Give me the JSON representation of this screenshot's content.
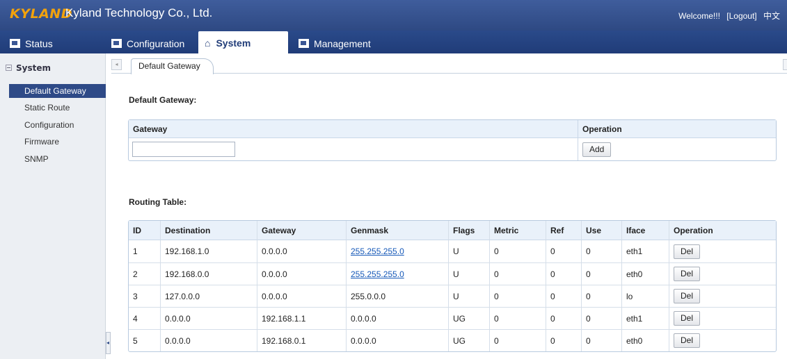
{
  "header": {
    "logo": "KYLAND",
    "company": "Kyland Technology Co., Ltd.",
    "welcome": "Welcome!!!",
    "logout": "[Logout]",
    "language": "中文"
  },
  "nav": {
    "tabs": [
      {
        "label": "Status",
        "icon": "status-icon"
      },
      {
        "label": "Configuration",
        "icon": "configuration-icon"
      },
      {
        "label": "System",
        "icon": "home-icon",
        "active": true
      },
      {
        "label": "Management",
        "icon": "management-icon"
      }
    ]
  },
  "sidebar": {
    "group": "System",
    "items": [
      {
        "label": "Default Gateway",
        "active": true
      },
      {
        "label": "Static Route"
      },
      {
        "label": "Configuration"
      },
      {
        "label": "Firmware"
      },
      {
        "label": "SNMP"
      }
    ]
  },
  "breadcrumb": {
    "tab": "Default Gateway"
  },
  "default_gateway": {
    "title": "Default Gateway:",
    "columns": [
      "Gateway",
      "Operation"
    ],
    "input_value": "",
    "add_label": "Add"
  },
  "routing": {
    "title": "Routing Table:",
    "columns": [
      "ID",
      "Destination",
      "Gateway",
      "Genmask",
      "Flags",
      "Metric",
      "Ref",
      "Use",
      "Iface",
      "Operation"
    ],
    "del_label": "Del",
    "rows": [
      [
        "1",
        "192.168.1.0",
        "0.0.0.0",
        "255.255.255.0",
        "U",
        "0",
        "0",
        "0",
        "eth1"
      ],
      [
        "2",
        "192.168.0.0",
        "0.0.0.0",
        "255.255.255.0",
        "U",
        "0",
        "0",
        "0",
        "eth0"
      ],
      [
        "3",
        "127.0.0.0",
        "0.0.0.0",
        "255.0.0.0",
        "U",
        "0",
        "0",
        "0",
        "lo"
      ],
      [
        "4",
        "0.0.0.0",
        "192.168.1.1",
        "0.0.0.0",
        "UG",
        "0",
        "0",
        "0",
        "eth1"
      ],
      [
        "5",
        "0.0.0.0",
        "192.168.0.1",
        "0.0.0.0",
        "UG",
        "0",
        "0",
        "0",
        "eth0"
      ]
    ]
  },
  "colors": {
    "header": "#2e4983",
    "accent": "#f2a20c",
    "link": "#1558b8"
  }
}
